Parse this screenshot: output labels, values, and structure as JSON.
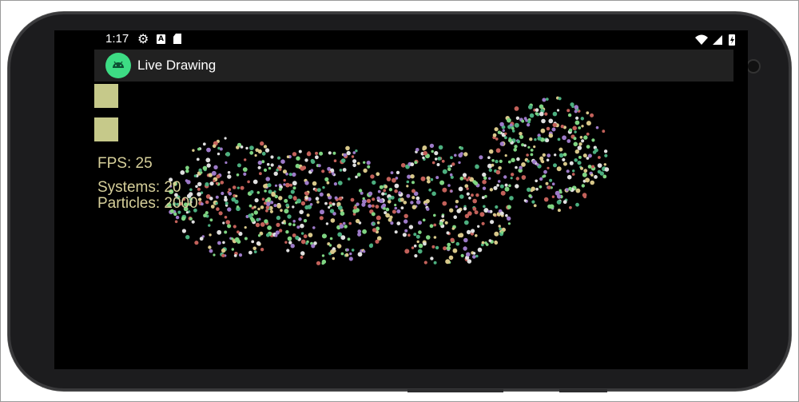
{
  "status_bar": {
    "time": "1:17",
    "icons": [
      "gear-icon",
      "keyboard-a-icon",
      "sd-card-icon",
      "wifi-icon",
      "signal-icon",
      "battery-charging-icon"
    ]
  },
  "app_bar": {
    "title": "Live Drawing",
    "icon": "android-robot-icon"
  },
  "hud": {
    "fps": "FPS: 25",
    "systems": "Systems: 20",
    "particles": "Particles: 2000"
  },
  "colors": {
    "screen_bg": "#000000",
    "app_bar": "#212121",
    "hud_text": "#d6cf9a",
    "square_buttons": "#c6c98a",
    "particle_palette": [
      "#7fd482",
      "#c3615a",
      "#9d7ac8",
      "#d8c88a",
      "#e0e0e0",
      "#4caf7f"
    ]
  }
}
